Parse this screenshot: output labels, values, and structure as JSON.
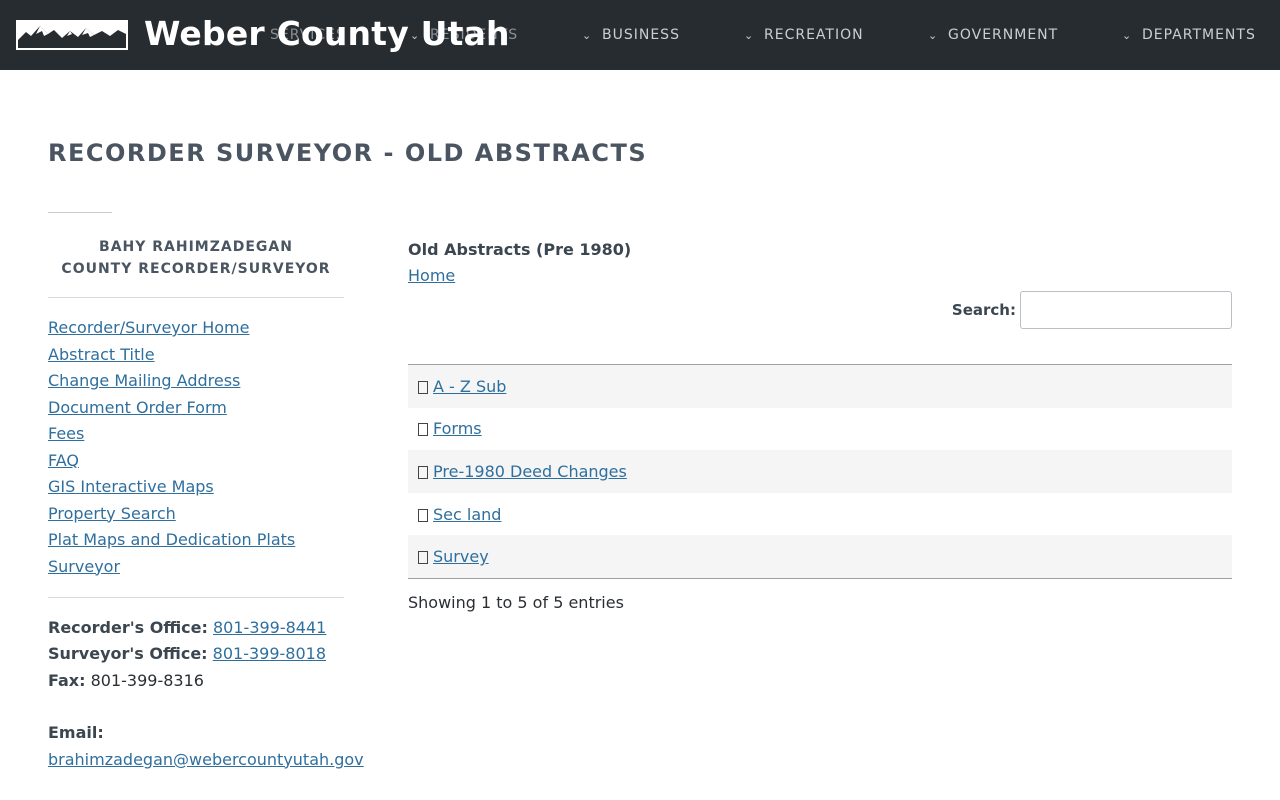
{
  "header": {
    "site_title": "Weber County Utah",
    "logo_icon": "mountain-logo",
    "nav": [
      {
        "label": "SERVICES"
      },
      {
        "label": "RESIDENTS"
      },
      {
        "label": "BUSINESS"
      },
      {
        "label": "RECREATION"
      },
      {
        "label": "GOVERNMENT"
      },
      {
        "label": "DEPARTMENTS"
      }
    ],
    "colors": {
      "background": "#272c31",
      "text": "#ffffff"
    }
  },
  "page": {
    "title": "RECORDER SURVEYOR - OLD ABSTRACTS"
  },
  "sidebar": {
    "official_name": "BAHY RAHIMZADEGAN",
    "official_title": "COUNTY RECORDER/SURVEYOR",
    "links": [
      "Recorder/Surveyor Home",
      "Abstract Title",
      "Change Mailing Address",
      "Document Order Form",
      "Fees",
      "FAQ",
      "GIS Interactive Maps",
      "Property Search",
      "Plat Maps and Dedication Plats",
      "Surveyor"
    ],
    "contact": {
      "recorder_label": "Recorder's Office:",
      "recorder_phone": "801-399-8441",
      "surveyor_label": "Surveyor's Office:",
      "surveyor_phone": "801-399-8018",
      "fax_label": "Fax:",
      "fax_number": "801-399-8316",
      "email_label": "Email:",
      "email": "brahimzadegan@webercountyutah.gov"
    }
  },
  "main": {
    "section_title": "Old Abstracts (Pre 1980)",
    "home_link": "Home",
    "search": {
      "label": "Search:",
      "value": "",
      "placeholder": ""
    },
    "folders": [
      {
        "icon": "folder-icon",
        "name": "A - Z Sub"
      },
      {
        "icon": "folder-icon",
        "name": "Forms"
      },
      {
        "icon": "folder-icon",
        "name": "Pre-1980 Deed Changes"
      },
      {
        "icon": "folder-icon",
        "name": "Sec land"
      },
      {
        "icon": "folder-icon",
        "name": "Survey"
      }
    ],
    "entries_info": "Showing 1 to 5 of 5 entries"
  },
  "colors": {
    "link": "#2f6f9e",
    "heading": "#4a5561",
    "stripe": "#f5f5f5"
  }
}
